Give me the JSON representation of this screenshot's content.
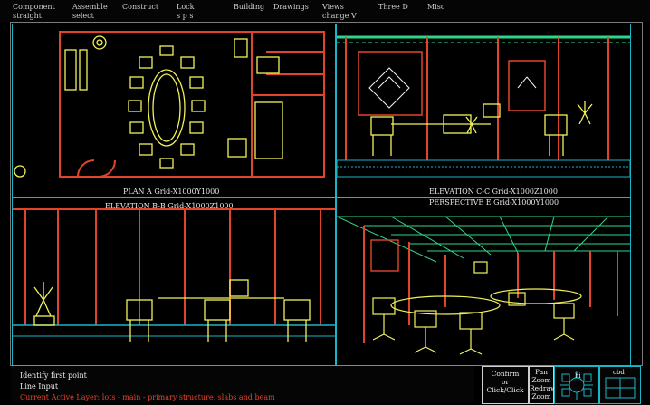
{
  "menu": {
    "row1": [
      "Component",
      "Assemble",
      "Construct",
      "Lock",
      "Building",
      "Drawings",
      "Views",
      "Three D",
      "Misc"
    ],
    "row2": [
      "straight",
      "select",
      "s p s",
      "change V"
    ]
  },
  "viewports": {
    "plan": "PLAN A Grid-X1000Y1000",
    "elev_c": "ELEVATION C-C Grid-X1000Z1000",
    "elev_b": "ELEVATION B-B Grid-X1000Z1000",
    "persp": "PERSPECTIVE E Grid-X1000Y1000"
  },
  "command": {
    "line1": "Identify first point",
    "line2": "Line Input",
    "line3": "Current Active Layer: lots - main - primary structure, slabs and beam"
  },
  "controls": {
    "confirm": "Confirm",
    "or": "or",
    "click": "Click/Click",
    "pan": "Pan",
    "zoom": "Zoom",
    "redraw": "Redraw",
    "zoom2": "Zoom",
    "hi": "hi",
    "cbd": "cbd"
  },
  "colors": {
    "wall": "#e0452c",
    "furniture": "#f2f25a",
    "grid": "#19b6c7",
    "ceiling": "#2fd68a",
    "plant": "#f4f4a0"
  }
}
